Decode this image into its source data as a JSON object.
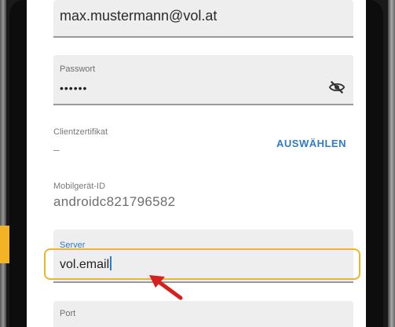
{
  "account": {
    "email_value": "max.mustermann@vol.at"
  },
  "password": {
    "label": "Passwort",
    "value": "••••••",
    "visibility_icon": "eye-off-icon"
  },
  "certificate": {
    "label": "Clientzertifikat",
    "value": "–",
    "select_label": "AUSWÄHLEN"
  },
  "device": {
    "label": "Mobilgerät-ID",
    "value": "androidc821796582"
  },
  "server": {
    "label": "Server",
    "value": "vol.email"
  },
  "port": {
    "label": "Port"
  },
  "colors": {
    "accent": "#2e7cc6",
    "highlight": "#f0b429",
    "arrow": "#d62020",
    "orange_tab": "#f4b324"
  }
}
